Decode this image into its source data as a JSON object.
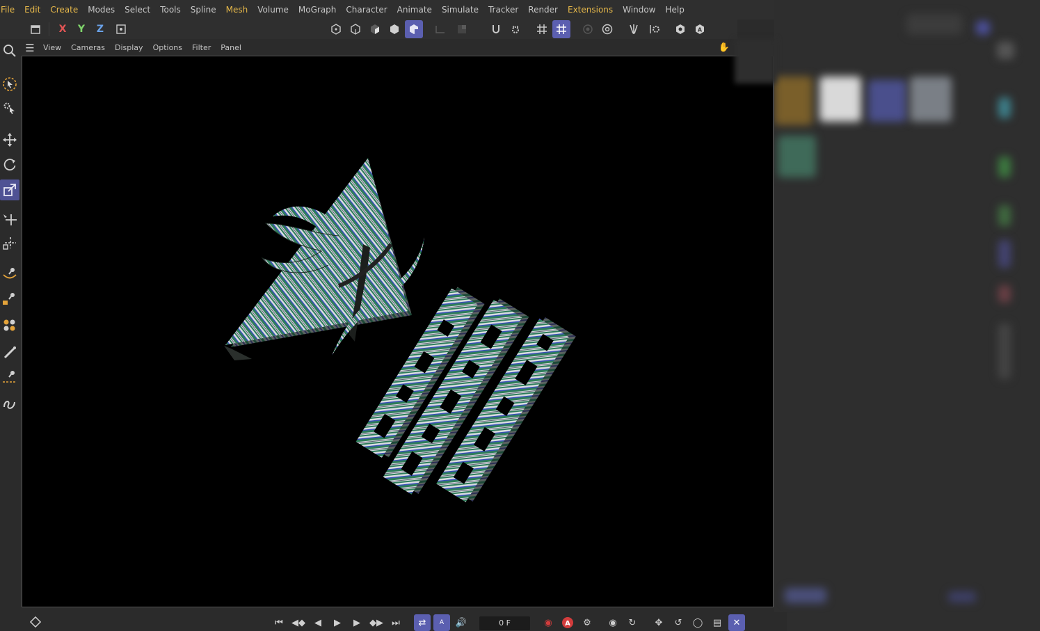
{
  "menubar": {
    "items": [
      "File",
      "Edit",
      "Create",
      "Modes",
      "Select",
      "Tools",
      "Spline",
      "Mesh",
      "Volume",
      "MoGraph",
      "Character",
      "Animate",
      "Simulate",
      "Tracker",
      "Render",
      "Extensions",
      "Window",
      "Help"
    ],
    "highlighted": [
      "File",
      "Edit",
      "Create",
      "Mesh",
      "Extensions"
    ]
  },
  "toolbar": {
    "axis_x": "X",
    "axis_y": "Y",
    "axis_z": "Z"
  },
  "viewport_menu": {
    "items": [
      "View",
      "Cameras",
      "Display",
      "Options",
      "Filter",
      "Panel"
    ]
  },
  "timeline": {
    "frame": "0 F",
    "autokey_label": "A"
  },
  "colors": {
    "accent": "#5b5fb0",
    "menu_highlight": "#e6b84a",
    "viewport_bg": "#000000",
    "stripe_green": "#2e7d5a",
    "stripe_blue": "#3b4fb8",
    "stripe_white": "#d8dde0",
    "record_red": "#d33c3c"
  },
  "icons": {
    "left_tools": [
      "live-selection-icon",
      "selection-tools-icon",
      "move-icon",
      "rotate-icon",
      "scale-icon",
      "transform-icon",
      "multi-transform-icon",
      "spline-pen-icon",
      "spline-tools-icon",
      "generators-icon",
      "paint-brush-icon",
      "spline-draw-icon",
      "sketch-icon"
    ],
    "top_toolbar": [
      "undo-icon",
      "axis-lock-icon",
      "world-coords-icon",
      "model-mode-icon",
      "points-mode-icon",
      "edges-mode-icon",
      "polygons-mode-icon",
      "object-mode-icon",
      "workplane-icon",
      "snap-icon",
      "snap-settings-icon",
      "grid-icon",
      "grid-snap-icon",
      "render-view-icon",
      "render-settings-icon",
      "mirror-icon",
      "settings-icon",
      "hide-icon",
      "auto-icon"
    ]
  }
}
